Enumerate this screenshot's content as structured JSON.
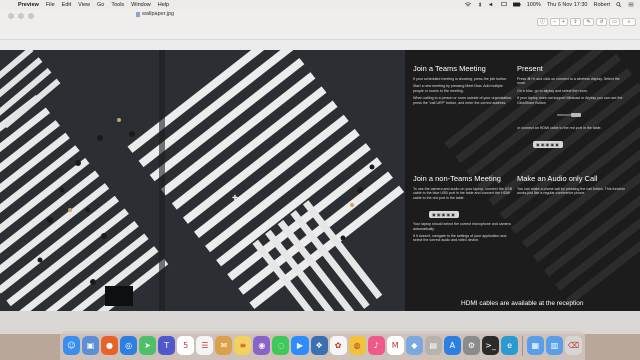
{
  "menubar": {
    "app_name": "Preview",
    "items": [
      "File",
      "Edit",
      "View",
      "Go",
      "Tools",
      "Window",
      "Help"
    ],
    "status": {
      "battery": "100%",
      "clock": "Thu 6 Nov  17:30",
      "user": "Robert"
    }
  },
  "window": {
    "document_title": "wallpaper.jpg",
    "toolbar_icons": [
      "info-icon",
      "zoom-out-icon",
      "zoom-in-icon",
      "share-icon",
      "markup-icon",
      "rotate-icon",
      "search-icon"
    ]
  },
  "poster": {
    "teams": {
      "title": "Join a Teams Meeting",
      "paragraphs": [
        "If your scheduled meeting is showing, press the join button.",
        "Start a new meeting by pressing Meet Now. Add multiple people or rooms to the meeting.",
        "When calling to a person or room outside of your organization, press the \"call URP\" button, and enter the correct address."
      ]
    },
    "present": {
      "title": "Present",
      "paragraphs": [
        "Press ⌘+K and click on connect to a wireless display. Select the room.",
        "On a Mac, go to airplay and select the room.",
        "If your laptop does not support Miracast or Airplay you can use the ClickShare Button"
      ],
      "hdmi_text": "or connect an HDMI cable to the red port in the table."
    },
    "non_teams": {
      "title": "Join a non-Teams Meeting",
      "paragraphs": [
        "To use the camera and audio on your laptop, connect the USB cable to the blue USB port in the table and connect the HDMI cable to the red port in the table.",
        "Your laptop should select the correct microphone and camera automatically.",
        "If it doesn't, navigate to the settings of your application and select the correct audio and video device."
      ]
    },
    "audio": {
      "title": "Make an Audio only Call",
      "paragraphs": [
        "You can make a phone call by pressing the call button. This function works just like a regular conference phone."
      ]
    },
    "footer": "HDMI cables are available at the reception"
  },
  "dock": {
    "apps": [
      {
        "name": "finder",
        "color": "#3a8ef0",
        "glyph": "☺"
      },
      {
        "name": "preview",
        "color": "#5d8fd6",
        "glyph": "▣"
      },
      {
        "name": "firefox",
        "color": "#e8632a",
        "glyph": "●"
      },
      {
        "name": "safari",
        "color": "#2d7fe2",
        "glyph": "◎"
      },
      {
        "name": "maps",
        "color": "#4fbf6a",
        "glyph": "➤"
      },
      {
        "name": "teams",
        "color": "#5059c9",
        "glyph": "T"
      },
      {
        "name": "calendar",
        "color": "#ffffff",
        "glyph": "5"
      },
      {
        "name": "reminders",
        "color": "#f4f4f4",
        "glyph": "☰"
      },
      {
        "name": "mail",
        "color": "#d9a24a",
        "glyph": "✉"
      },
      {
        "name": "notes",
        "color": "#f2d15f",
        "glyph": "≡"
      },
      {
        "name": "intune",
        "color": "#8a63c8",
        "glyph": "◉"
      },
      {
        "name": "messages",
        "color": "#3ec95a",
        "glyph": "◌"
      },
      {
        "name": "zoom",
        "color": "#2d8cff",
        "glyph": "▶"
      },
      {
        "name": "vmware",
        "color": "#3a6fb0",
        "glyph": "❖"
      },
      {
        "name": "photos",
        "color": "#f5f5f5",
        "glyph": "✿"
      },
      {
        "name": "chrome",
        "color": "#f0c43a",
        "glyph": "◍"
      },
      {
        "name": "itunes",
        "color": "#f05a8a",
        "glyph": "♪"
      },
      {
        "name": "office",
        "color": "#ffffff",
        "glyph": "M"
      },
      {
        "name": "photoshop",
        "color": "#7aa9e0",
        "glyph": "◆"
      },
      {
        "name": "contacts",
        "color": "#b8b2ad",
        "glyph": "▤"
      },
      {
        "name": "app-store",
        "color": "#2d7fe2",
        "glyph": "A"
      },
      {
        "name": "settings",
        "color": "#8b8b8b",
        "glyph": "⚙"
      },
      {
        "name": "terminal",
        "color": "#2b2b2b",
        "glyph": ">_"
      },
      {
        "name": "edge",
        "color": "#2a9ad0",
        "glyph": "e"
      },
      {
        "name": "downloads",
        "color": "#5a9ee8",
        "glyph": "▦"
      },
      {
        "name": "documents",
        "color": "#5a9ee8",
        "glyph": "▥"
      },
      {
        "name": "trash",
        "color": "#d8d6d4",
        "glyph": "⌫"
      }
    ]
  }
}
